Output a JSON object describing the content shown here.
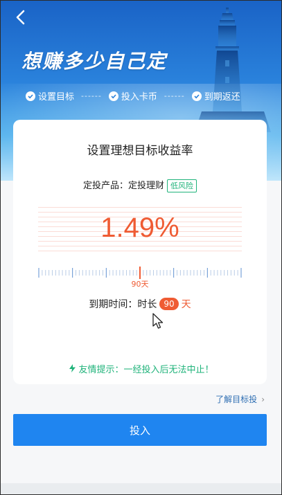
{
  "header": {
    "title": "想赚多少自己定",
    "back_icon": "chevron-left-icon"
  },
  "steps": [
    {
      "label": "设置目标"
    },
    {
      "label": "投入卡币"
    },
    {
      "label": "到期返还"
    }
  ],
  "steps_separator": "------",
  "card": {
    "title": "设置理想目标收益率",
    "product_prefix": "定投产品：定投理财",
    "risk_badge": "低风险",
    "rate": "1.49%",
    "ruler_value": "90天",
    "term_label": "到期时间：时长",
    "term_value": "90",
    "term_unit": "天"
  },
  "tip": {
    "text": "友情提示：一经投入后无法中止！"
  },
  "learn_link": "了解目标投",
  "invest_button": "投入",
  "colors": {
    "accent_orange": "#ef5b33",
    "button_blue": "#1f85f0",
    "risk_green": "#1fb37a"
  }
}
